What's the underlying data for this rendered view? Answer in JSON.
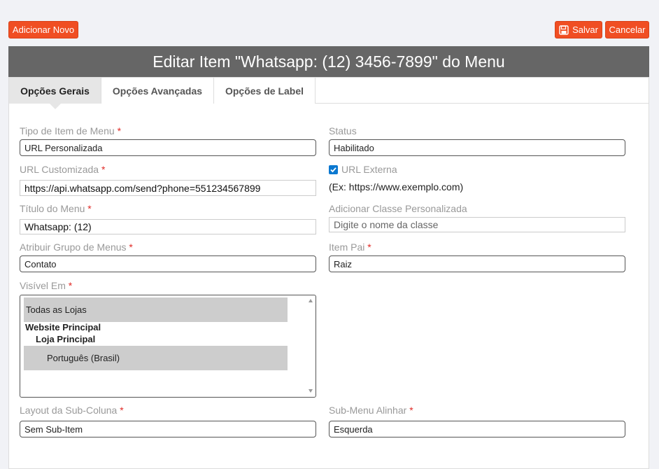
{
  "toolbar": {
    "add_new": "Adicionar Novo",
    "save": "Salvar",
    "cancel": "Cancelar"
  },
  "header": {
    "title": "Editar Item \"Whatsapp: (12) 3456-7899\" do Menu"
  },
  "tabs": [
    {
      "label": "Opções Gerais",
      "active": true
    },
    {
      "label": "Opções Avançadas",
      "active": false
    },
    {
      "label": "Opções de Label",
      "active": false
    }
  ],
  "form": {
    "menu_item_type": {
      "label": "Tipo de Item de Menu",
      "required": "*",
      "value": "URL Personalizada"
    },
    "status": {
      "label": "Status",
      "value": "Habilitado"
    },
    "custom_url": {
      "label": "URL Customizada",
      "required": "*",
      "value": "https://api.whatsapp.com/send?phone=551234567899"
    },
    "external_url": {
      "label": "URL Externa",
      "checked": true,
      "hint": "(Ex: https://www.exemplo.com)"
    },
    "menu_title": {
      "label": "Título do Menu",
      "required": "*",
      "value": "Whatsapp: (12)"
    },
    "custom_class": {
      "label": "Adicionar Classe Personalizada",
      "placeholder": "Digite o nome da classe"
    },
    "menu_group": {
      "label": "Atribuir Grupo de Menus",
      "required": "*",
      "value": "Contato"
    },
    "parent_item": {
      "label": "Item Pai",
      "required": "*",
      "value": "Raiz"
    },
    "visible_in": {
      "label": "Visível Em",
      "required": "*",
      "options": [
        "Todas as Lojas",
        "Website Principal",
        "Loja Principal",
        "Português (Brasil)"
      ]
    },
    "sub_column_layout": {
      "label": "Layout da Sub-Coluna",
      "required": "*",
      "value": "Sem Sub-Item"
    },
    "submenu_align": {
      "label": "Sub-Menu Alinhar",
      "required": "*",
      "value": "Esquerda"
    }
  },
  "colors": {
    "accent": "#f04e23",
    "header_bg": "#666666",
    "checkbox": "#0b78d0",
    "required": "#e02b27"
  }
}
